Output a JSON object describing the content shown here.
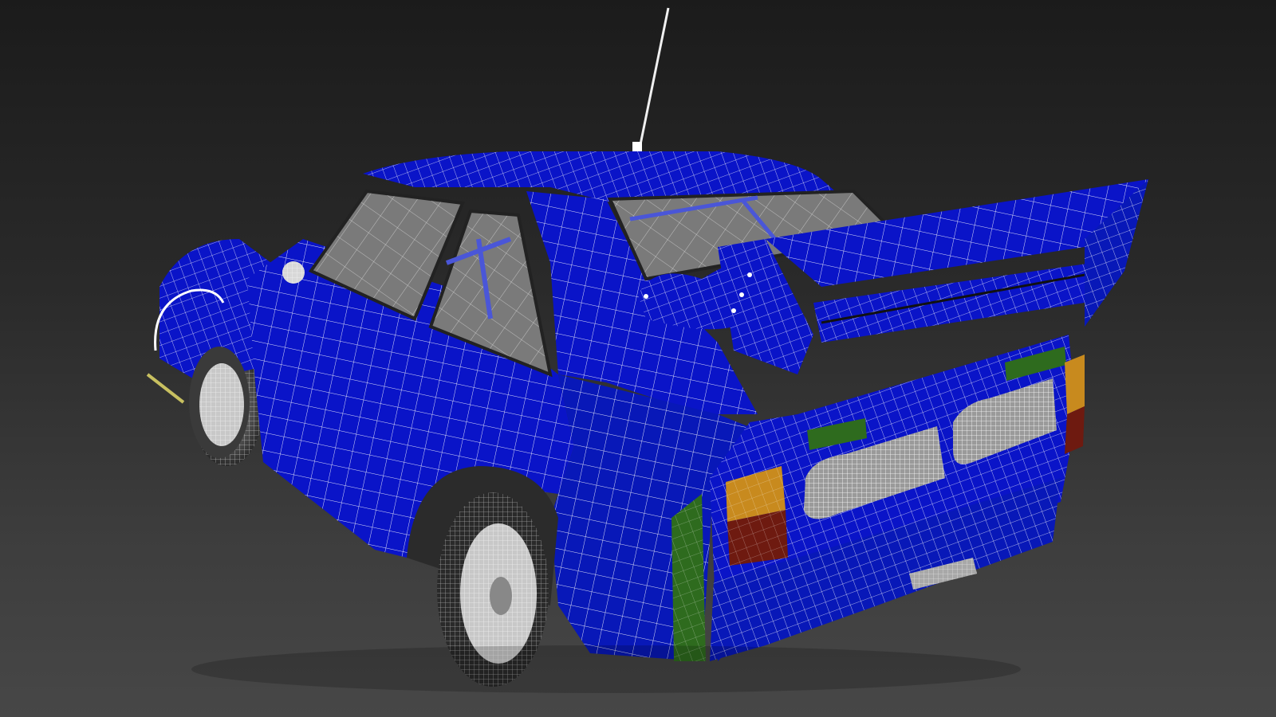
{
  "viewport": {
    "background_top": "#1b1b1b",
    "background_bottom": "#474747"
  },
  "car_model": {
    "body_color": "#0a14c8",
    "body_shade": "#061098",
    "wire_color": "#ffffff",
    "glass_color": "#7a7a7a",
    "license_plate_color": "#2e6b1e",
    "taillight_amber": "#c88a1e",
    "taillight_red": "#6e1a10",
    "tire_color": "#2a2a2a"
  }
}
